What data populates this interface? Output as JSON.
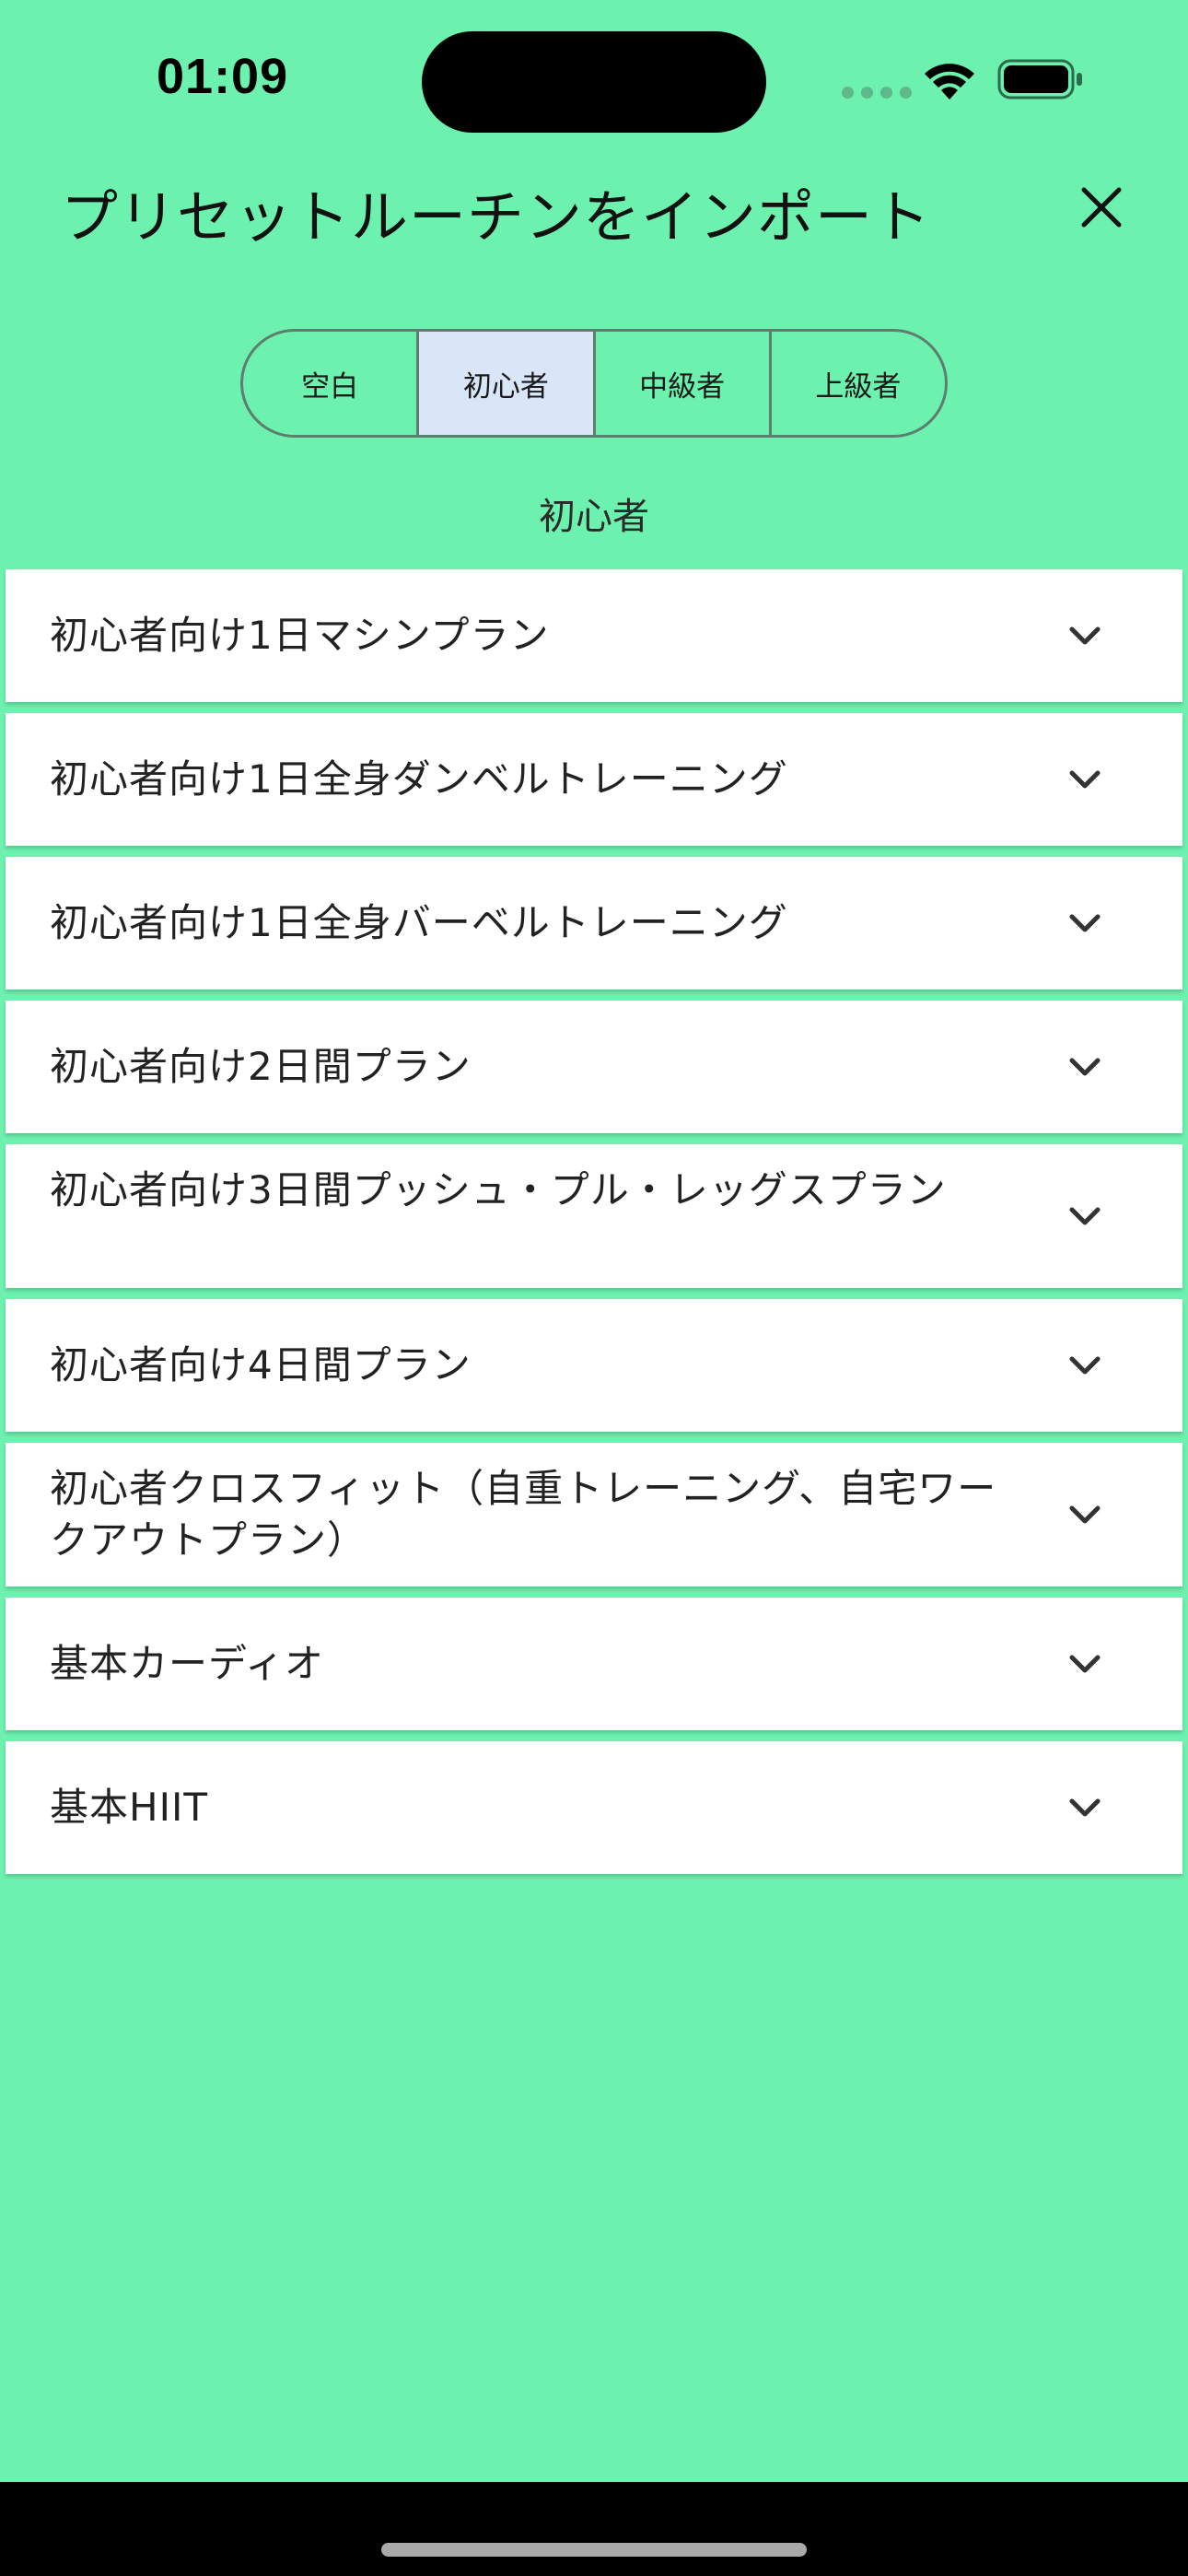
{
  "status_bar": {
    "time": "01:09"
  },
  "header": {
    "title": "プリセットルーチンをインポート",
    "close_icon": "close-icon"
  },
  "segments": [
    {
      "label": "空白",
      "selected": false
    },
    {
      "label": "初心者",
      "selected": true
    },
    {
      "label": "中級者",
      "selected": false
    },
    {
      "label": "上級者",
      "selected": false
    }
  ],
  "section_label": "初心者",
  "routines": [
    {
      "label": "初心者向け1日マシンプラン"
    },
    {
      "label": "初心者向け1日全身ダンベルトレーニング"
    },
    {
      "label": "初心者向け1日全身バーベルトレーニング"
    },
    {
      "label": "初心者向け2日間プラン"
    },
    {
      "label": "初心者向け3日間プッシュ・プル・レッグスプラン"
    },
    {
      "label": "初心者向け4日間プラン"
    },
    {
      "label": "初心者クロスフィット（自重トレーニング、自宅ワークアウトプラン）"
    },
    {
      "label": "基本カーディオ"
    },
    {
      "label": "基本HIIT"
    }
  ],
  "colors": {
    "background": "#6cf2ae",
    "selected_segment": "#d8e6f8",
    "card": "#ffffff"
  }
}
